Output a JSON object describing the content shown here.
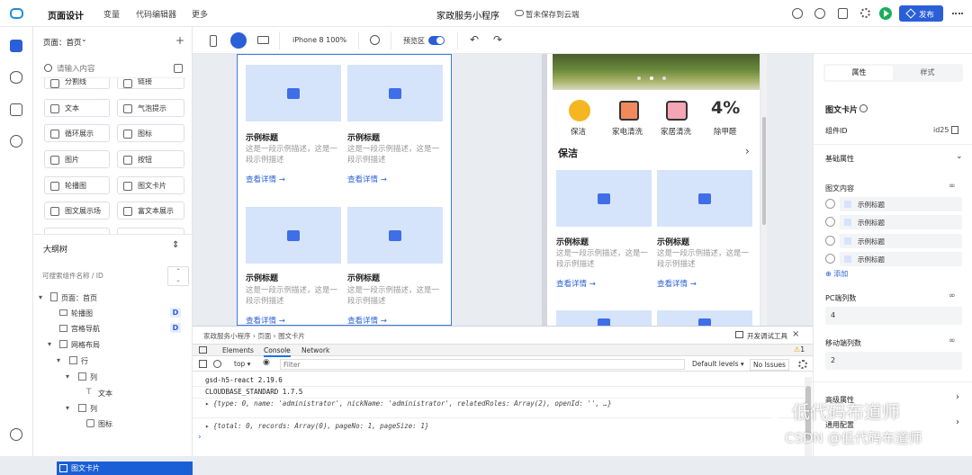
{
  "topbar": {
    "menu": [
      "页面设计",
      "变量",
      "代码编辑器",
      "更多"
    ],
    "app_title": "家政服务小程序",
    "save_status": "暂未保存到云端",
    "publish_label": "发布"
  },
  "left": {
    "page_selector": "页面：首页",
    "search_placeholder": "请输入内容",
    "components": [
      [
        "分割线",
        "链接"
      ],
      [
        "文本",
        "气泡提示"
      ],
      [
        "循环展示",
        "图标"
      ],
      [
        "图片",
        "按钮"
      ],
      [
        "轮播图",
        "图文卡片"
      ],
      [
        "图文展示场",
        "富文本展示"
      ]
    ],
    "outline_title": "大纲树",
    "outline_search_placeholder": "可搜索组件名称 / ID",
    "tree": [
      {
        "label": "页面：首页",
        "badge": ""
      },
      {
        "label": "轮播图",
        "badge": "D"
      },
      {
        "label": "宫格导航",
        "badge": "D"
      },
      {
        "label": "网格布局",
        "badge": ""
      },
      {
        "label": "行",
        "badge": ""
      },
      {
        "label": "列",
        "badge": ""
      },
      {
        "label": "文本",
        "badge": ""
      },
      {
        "label": "列",
        "badge": ""
      },
      {
        "label": "图标",
        "badge": ""
      },
      {
        "label": "图文卡片",
        "badge": ""
      }
    ]
  },
  "toolbar": {
    "device": "iPhone 8 100%",
    "preview_label": "预览区"
  },
  "canvas": {
    "card_title": "示例标题",
    "card_desc": "这是一段示例描述，这是一段示例描述",
    "card_link": "查看详情",
    "nav_items": [
      "保洁",
      "家电清洗",
      "家居清洗",
      "除甲醛"
    ],
    "section_title": "保洁"
  },
  "devtools": {
    "breadcrumb": [
      "家政服务小程序",
      "页面",
      "图文卡片"
    ],
    "devtool_label": "开发调试工具",
    "tabs": [
      "Elements",
      "Console",
      "Network"
    ],
    "warning_count": "1",
    "context": "top",
    "filter_placeholder": "Filter",
    "levels": "Default levels",
    "no_issues": "No Issues",
    "logs": [
      "gsd-h5-react 2.19.6",
      "CLOUDBASE_STANDARD 1.7.5",
      "{type: 0, name: 'administrator', nickName: 'administrator', relatedRoles: Array(2), openId: '', …}",
      "{total: 0, records: Array(0), pageNo: 1, pageSize: 1}"
    ]
  },
  "right": {
    "tabs": [
      "属性",
      "样式"
    ],
    "section_title": "图文卡片",
    "component_id_label": "组件ID",
    "component_id": "id25",
    "basic_props": "基础属性",
    "content_label": "图文内容",
    "content_items": [
      "示例标题",
      "示例标题",
      "示例标题",
      "示例标题"
    ],
    "add_label": "添加",
    "pc_cols_label": "PC端列数",
    "pc_cols": "4",
    "mobile_cols_label": "移动端列数",
    "mobile_cols": "2",
    "advanced": "高级属性",
    "common": "通用配置"
  },
  "watermark": {
    "line1": "低代码布道师",
    "line2": "CSDN @低代码布道师"
  },
  "colors": {
    "primary": "#2a5fd8",
    "selected": "#1a5fd6",
    "placeholder": "#d6e4fb",
    "accent_green": "#1aad5b"
  }
}
